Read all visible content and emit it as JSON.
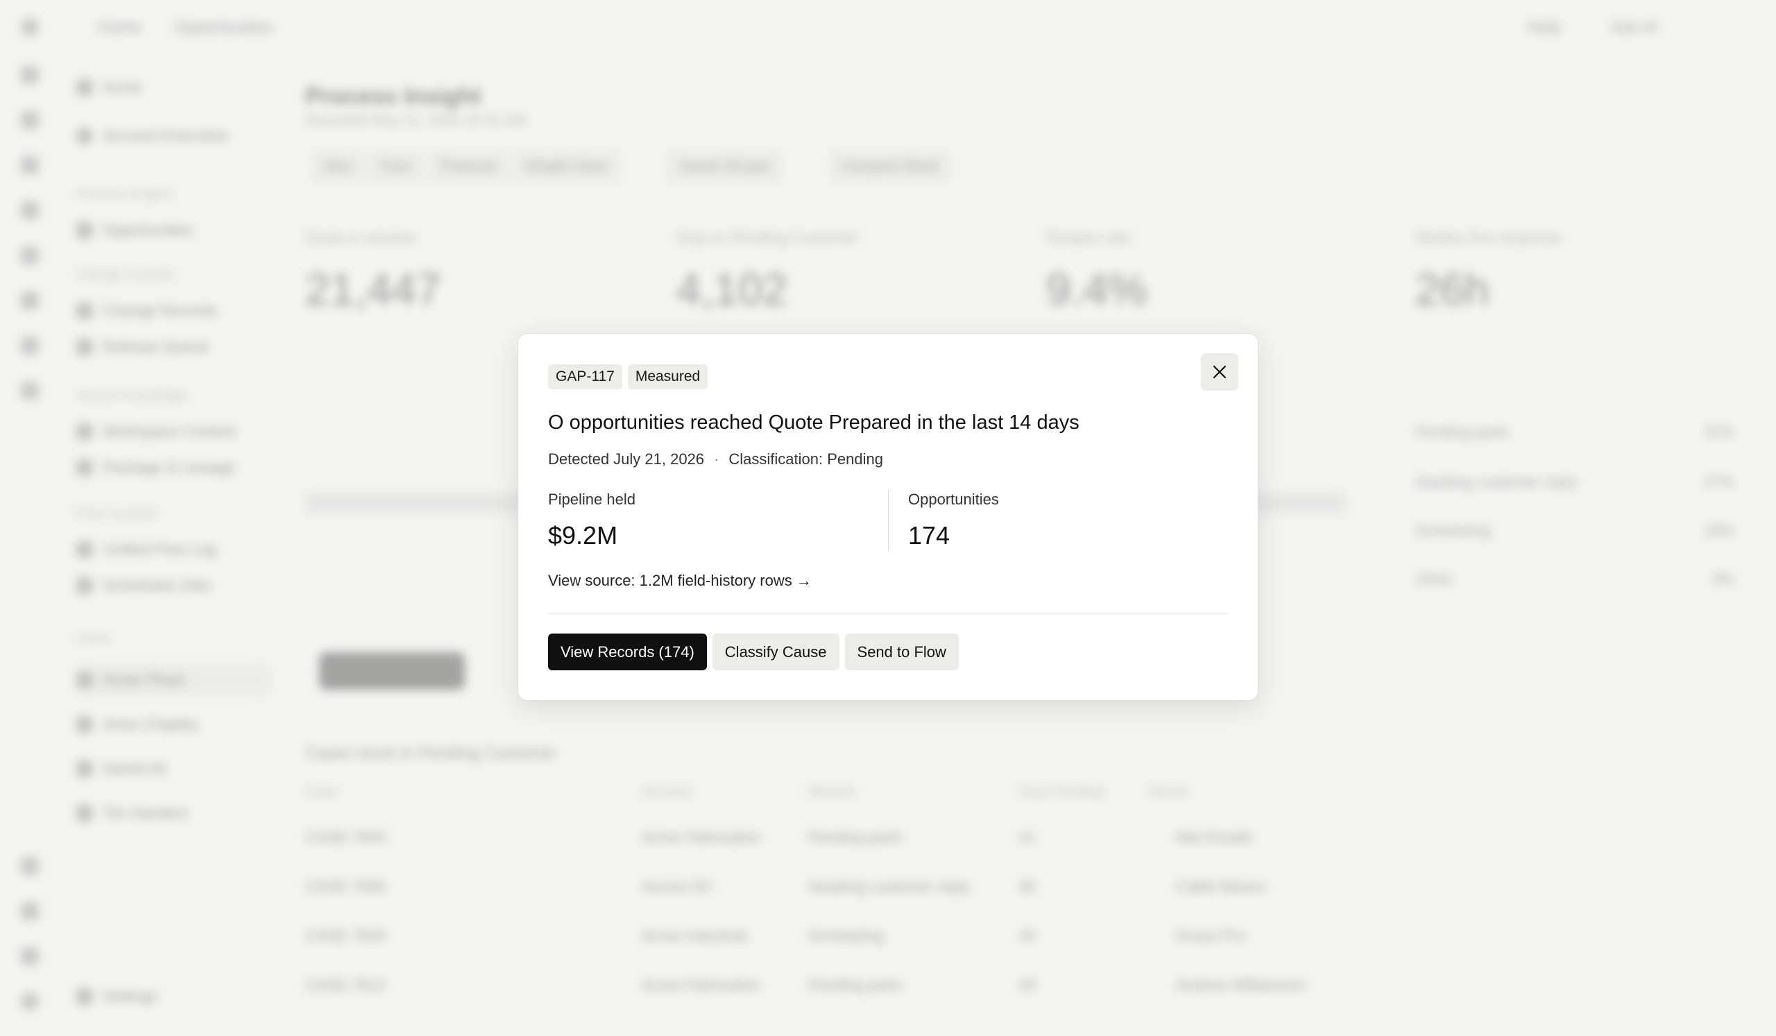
{
  "modal": {
    "tags": [
      "GAP-117",
      "Measured"
    ],
    "title": "O opportunities reached Quote Prepared in the last 14 days",
    "detected": "Detected July 21, 2026",
    "separator": "·",
    "classification": "Classification: Pending",
    "stats": [
      {
        "label": "Pipeline held",
        "value": "$9.2M"
      },
      {
        "label": "Opportunities",
        "value": "174"
      }
    ],
    "source_link": "View source: 1.2M field-history rows →",
    "buttons": {
      "view_records": "View Records (174)",
      "classify": "Classify Cause",
      "send": "Send to Flow"
    }
  },
  "background": {
    "breadcrumb": [
      "Home",
      "Opportunities"
    ],
    "top_actions": [
      "Help",
      "Ask AI"
    ],
    "org": "Acme",
    "user": "Account Executive",
    "sidebar_sections": [
      {
        "group": "Process Insights",
        "items": [
          "Opportunities"
        ]
      },
      {
        "group": "Change Controls",
        "items": [
          "Change Records",
          "Release Queue"
        ]
      },
      {
        "group": "Source Knowledge",
        "items": [
          "Workspace Context",
          "Package & Lineage"
        ]
      },
      {
        "group": "Flow Controls",
        "items": [
          "Unified Flow Log",
          "Scheduled Jobs"
        ]
      }
    ],
    "users_header": "Users",
    "users": [
      "Annie Pham",
      "Anne Chapley",
      "Daniel Ali",
      "Tim Sanders"
    ],
    "settings": "Settings",
    "page_title": "Process Insight",
    "page_subtitle": "Recorded May 21, 2026 10:42 AM",
    "filters": [
      "Mon",
      "Tues",
      "Products",
      "Weight Class",
      "Owner All type",
      "Compare Week"
    ],
    "metrics": [
      {
        "label": "Deals in window",
        "value": "21,447"
      },
      {
        "label": "Days in Pending Customer",
        "value": "4,102"
      },
      {
        "label": "Reopen rate",
        "value": "9.4%"
      },
      {
        "label": "Median first response",
        "value": "26h"
      }
    ],
    "right_panel": [
      {
        "label": "Pending parts",
        "value": "31%"
      },
      {
        "label": "Awaiting customer reply",
        "value": "27%"
      },
      {
        "label": "Scheduling",
        "value": "18%"
      },
      {
        "label": "Other",
        "value": "9%"
      }
    ],
    "table_title": "Cases stuck in Pending Customer",
    "table_headers": [
      "Case",
      "Account",
      "Reason",
      "Days Pending",
      "Owner"
    ],
    "table_rows": [
      [
        "CASE-7840",
        "Acme Fabrication",
        "Pending parts",
        "41",
        "Mai Kovalic"
      ],
      [
        "CASE-7836",
        "Aurora DC",
        "Awaiting customer reply",
        "36",
        "Caleb Mason"
      ],
      [
        "CASE-7829",
        "Acme Industrial",
        "Scheduling",
        "34",
        "Grace Pro"
      ],
      [
        "CASE-7812",
        "Acme Fabrication",
        "Pending parts",
        "29",
        "Andrew Williamson"
      ]
    ]
  }
}
